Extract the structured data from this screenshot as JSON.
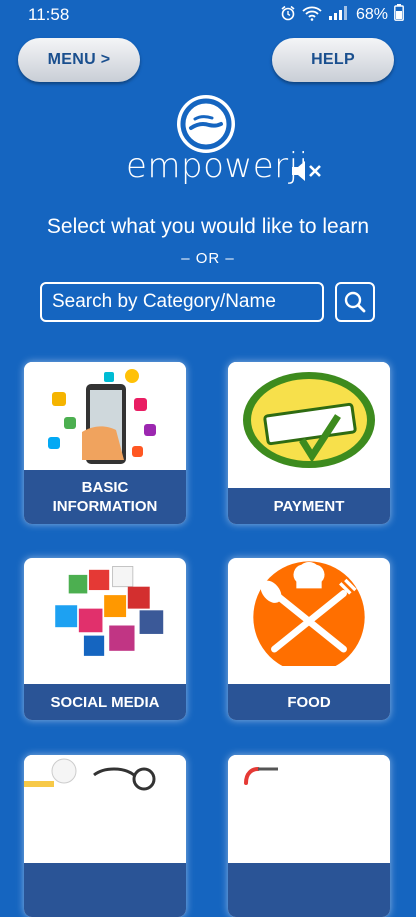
{
  "status_bar": {
    "time": "11:58",
    "battery": "68%",
    "icons": [
      "alarm-icon",
      "wifi-icon",
      "signal-icon",
      "battery-icon"
    ]
  },
  "header": {
    "menu_label": "MENU >",
    "help_label": "HELP"
  },
  "brand": {
    "name": "empowerji"
  },
  "main": {
    "prompt": "Select what you would like to learn",
    "or_text": "– OR –",
    "search_placeholder": "Search by Category/Name"
  },
  "categories": [
    {
      "label": "BASIC INFORMATION",
      "icon": "smartphone-apps-icon"
    },
    {
      "label": "PAYMENT",
      "icon": "pay-online-icon"
    },
    {
      "label": "SOCIAL MEDIA",
      "icon": "social-media-cubes-icon"
    },
    {
      "label": "FOOD",
      "icon": "chef-cutlery-icon"
    },
    {
      "label": "",
      "icon": "health-icon"
    },
    {
      "label": "",
      "icon": "shopping-icon"
    }
  ],
  "colors": {
    "background": "#1565c0",
    "label_bar": "#2a5496",
    "button_text": "#1a4f8e"
  }
}
